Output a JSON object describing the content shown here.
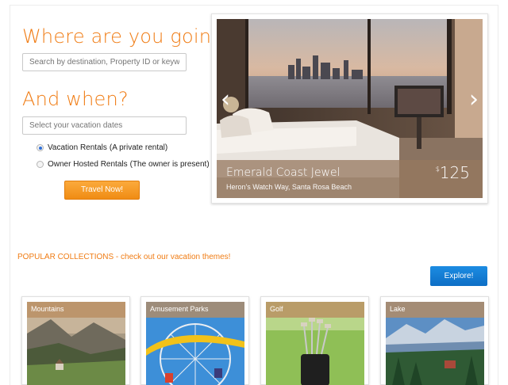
{
  "search": {
    "heading": "Where are you going?",
    "placeholder": "Search by destination, Property ID or keyword"
  },
  "dates": {
    "heading": "And when?",
    "placeholder": "Select your vacation dates"
  },
  "rental_type": {
    "options": [
      {
        "label": "Vacation Rentals",
        "note": "(A private rental)",
        "selected": true
      },
      {
        "label": "Owner Hosted Rentals",
        "note": "(The owner is present)",
        "selected": false
      }
    ]
  },
  "travel_button": "Travel Now!",
  "hero": {
    "title": "Emerald Coast Jewel",
    "subtitle": "Heron's Watch Way, Santa Rosa Beach",
    "currency": "$",
    "price": "125",
    "prev_icon": "chevron-left-icon",
    "next_icon": "chevron-right-icon"
  },
  "collections": {
    "title": "POPULAR COLLECTIONS - check out our vacation themes!",
    "explore_label": "Explore!",
    "items": [
      {
        "label": "Mountains"
      },
      {
        "label": "Amusement Parks"
      },
      {
        "label": "Golf"
      },
      {
        "label": "Lake"
      }
    ]
  },
  "colors": {
    "accent": "#f07c14",
    "button_orange": "#f08c14",
    "button_blue": "#0d6ec5"
  }
}
